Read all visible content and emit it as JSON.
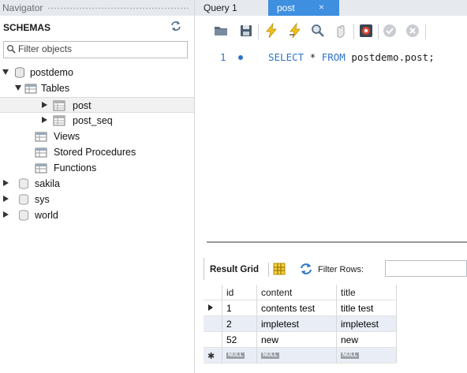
{
  "navigator": {
    "title": "Navigator",
    "schemas_label": "SCHEMAS",
    "filter_placeholder": "Filter objects",
    "tree": {
      "postdemo": "postdemo",
      "tables": "Tables",
      "post": "post",
      "post_seq": "post_seq",
      "views": "Views",
      "stored_procedures": "Stored Procedures",
      "functions": "Functions",
      "sakila": "sakila",
      "sys": "sys",
      "world": "world"
    }
  },
  "tabs": {
    "query1": "Query 1",
    "post": "post",
    "close_glyph": "×"
  },
  "editor": {
    "line_number": "1",
    "sql_kw1": "SELECT",
    "sql_star": " * ",
    "sql_kw2": "FROM",
    "sql_rest": " postdemo.post;"
  },
  "result": {
    "title": "Result Grid",
    "filter_label": "Filter Rows:",
    "columns": [
      "id",
      "content",
      "title"
    ],
    "rows": [
      [
        "1",
        "contents test",
        "title test"
      ],
      [
        "2",
        "impletest",
        "impletest"
      ],
      [
        "52",
        "new",
        "new"
      ]
    ],
    "null_text": "NULL"
  },
  "colors": {
    "accent_tab": "#3e8fe0",
    "keyword": "#2f74c9",
    "alt_row": "#e9eef6"
  },
  "icons": [
    "refresh-icon",
    "search-icon",
    "database-icon",
    "table-folder-icon",
    "table-icon",
    "open-folder-icon",
    "save-icon",
    "execute-icon",
    "execute-current-icon",
    "explain-icon",
    "stop-icon",
    "toggle-error-icon",
    "commit-icon",
    "rollback-icon",
    "grid-icon"
  ]
}
